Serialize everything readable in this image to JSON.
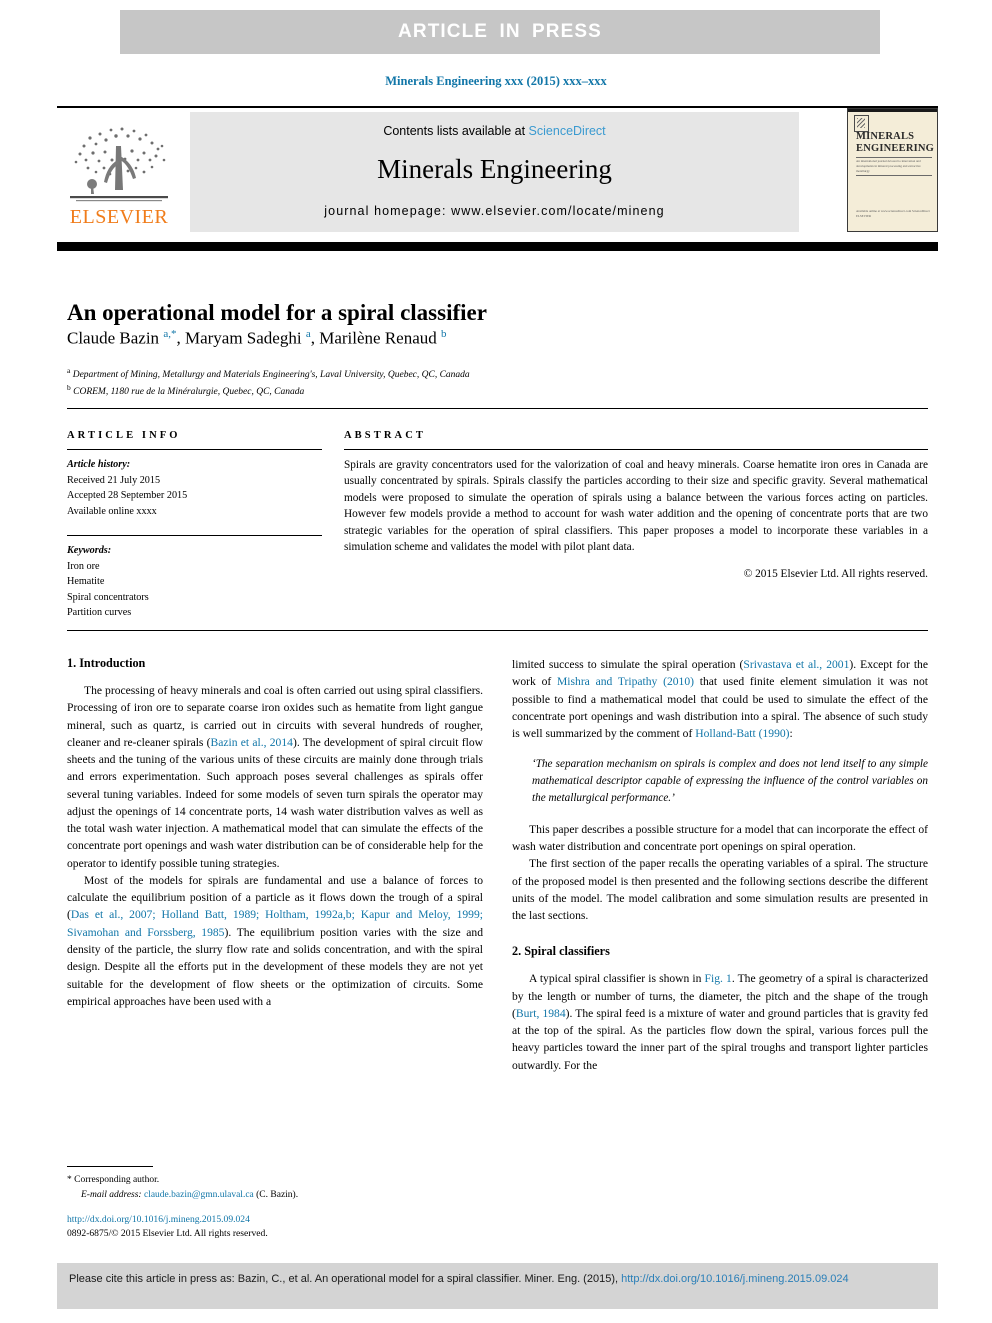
{
  "banner": {
    "label": "ARTICLE IN PRESS"
  },
  "journal_ref": "Minerals Engineering xxx (2015) xxx–xxx",
  "masthead": {
    "contents_prefix": "Contents lists available at ",
    "sciencedirect": "ScienceDirect",
    "journal_title": "Minerals Engineering",
    "homepage": "journal homepage: www.elsevier.com/locate/mineng",
    "publisher_wordmark": "ELSEVIER",
    "cover": {
      "title_line1": "MINERALS",
      "title_line2": "ENGINEERING",
      "subtitle": "An international journal devoted to innovation and developments in mineral processing and extractive metallurgy",
      "footer": "Available online at www.sciencedirect.com  ScienceDirect  ELSEVIER"
    }
  },
  "article": {
    "title": "An operational model for a spiral classifier",
    "authors_html": "Claude Bazin <sup>a,*</sup>, Maryam Sadeghi <sup>a</sup>, Marilène Renaud <sup>b</sup>",
    "affiliation_a": "Department of Mining, Metallurgy and Materials Engineering's, Laval University, Quebec, QC, Canada",
    "affiliation_b": "COREM, 1180 rue de la Minéralurgie, Quebec, QC, Canada",
    "affiliation_a_marker": "a",
    "affiliation_b_marker": "b"
  },
  "info": {
    "heading": "ARTICLE INFO",
    "history_label": "Article history:",
    "received": "Received 21 July 2015",
    "accepted": "Accepted 28 September 2015",
    "available": "Available online xxxx",
    "keywords_label": "Keywords:",
    "keywords": [
      "Iron ore",
      "Hematite",
      "Spiral concentrators",
      "Partition curves"
    ]
  },
  "abstract": {
    "heading": "ABSTRACT",
    "text": "Spirals are gravity concentrators used for the valorization of coal and heavy minerals. Coarse hematite iron ores in Canada are usually concentrated by spirals. Spirals classify the particles according to their size and specific gravity. Several mathematical models were proposed to simulate the operation of spirals using a balance between the various forces acting on particles. However few models provide a method to account for wash water addition and the opening of concentrate ports that are two strategic variables for the operation of spiral classifiers. This paper proposes a model to incorporate these variables in a simulation scheme and validates the model with pilot plant data.",
    "copyright": "© 2015 Elsevier Ltd. All rights reserved."
  },
  "sections": {
    "intro_heading": "1. Introduction",
    "intro_p1_a": "The processing of heavy minerals and coal is often carried out using spiral classifiers. Processing of iron ore to separate coarse iron oxides such as hematite from light gangue mineral, such as quartz, is carried out in circuits with several hundreds of rougher, cleaner and re-cleaner spirals (",
    "intro_p1_ref": "Bazin et al., 2014",
    "intro_p1_b": "). The development of spiral circuit flow sheets and the tuning of the various units of these circuits are mainly done through trials and errors experimentation. Such approach poses several challenges as spirals offer several tuning variables. Indeed for some models of seven turn spirals the operator may adjust the openings of 14 concentrate ports, 14 wash water distribution valves as well as the total wash water injection. A mathematical model that can simulate the effects of the concentrate port openings and wash water distribution can be of considerable help for the operator to identify possible tuning strategies.",
    "intro_p2_a": "Most of the models for spirals are fundamental and use a balance of forces to calculate the equilibrium position of a particle as it flows down the trough of a spiral (",
    "intro_p2_ref": "Das et al., 2007; Holland Batt, 1989; Holtham, 1992a,b; Kapur and Meloy, 1999; Sivamohan and Forssberg, 1985",
    "intro_p2_b": "). The equilibrium position varies with the size and density of the particle, the slurry flow rate and solids concentration, and with the spiral design. Despite all the efforts put in the development of these models they are not yet suitable for the development of flow sheets or the optimization of circuits. Some empirical approaches have been used with a",
    "right_p1_a": "limited success to simulate the spiral operation (",
    "right_p1_ref1": "Srivastava et al., 2001",
    "right_p1_b": "). Except for the work of ",
    "right_p1_ref2": "Mishra and Tripathy (2010)",
    "right_p1_c": " that used finite element simulation it was not possible to find a mathematical model that could be used to simulate the effect of the concentrate port openings and wash distribution into a spiral. The absence of such study is well summarized by the comment of ",
    "right_p1_ref3": "Holland-Batt (1990)",
    "right_p1_d": ":",
    "quote": "‘The separation mechanism on spirals is complex and does not lend itself to any simple mathematical descriptor capable of expressing the influence of the control variables on the metallurgical performance.’",
    "right_p2": "This paper describes a possible structure for a model that can incorporate the effect of wash water distribution and concentrate port openings on spiral operation.",
    "right_p3": "The first section of the paper recalls the operating variables of a spiral. The structure of the proposed model is then presented and the following sections describe the different units of the model. The model calibration and some simulation results are presented in the last sections.",
    "spiral_heading": "2. Spiral classifiers",
    "spiral_p1_a": "A typical spiral classifier is shown in ",
    "spiral_p1_figref": "Fig. 1",
    "spiral_p1_b": ". The geometry of a spiral is characterized by the length or number of turns, the diameter, the pitch and the shape of the trough (",
    "spiral_p1_ref": "Burt, 1984",
    "spiral_p1_c": "). The spiral feed is a mixture of water and ground particles that is gravity fed at the top of the spiral. As the particles flow down the spiral, various forces pull the heavy particles toward the inner part of the spiral troughs and transport lighter particles outwardly. For the"
  },
  "footnote": {
    "star": "*",
    "corresponding": "Corresponding author.",
    "email_label": "E-mail address:",
    "email": "claude.bazin@gmn.ulaval.ca",
    "email_suffix": "(C. Bazin)."
  },
  "bottom": {
    "doi": "http://dx.doi.org/10.1016/j.mineng.2015.09.024",
    "issn_line": "0892-6875/© 2015 Elsevier Ltd. All rights reserved."
  },
  "citation": {
    "text_prefix": "Please cite this article in press as: Bazin, C., et al. An operational model for a spiral classifier. Miner. Eng. (2015), ",
    "doi_link": "http://dx.doi.org/10.1016/j.mineng.2015.09.024"
  },
  "colors": {
    "link": "#1176a8",
    "sciencedirect": "#3a9ad0",
    "elsevier_orange": "#f07c1a",
    "banner_bg": "#c6c6c6",
    "masthead_bg": "#e6e6e6",
    "cite_bg": "#d4d4d4"
  }
}
